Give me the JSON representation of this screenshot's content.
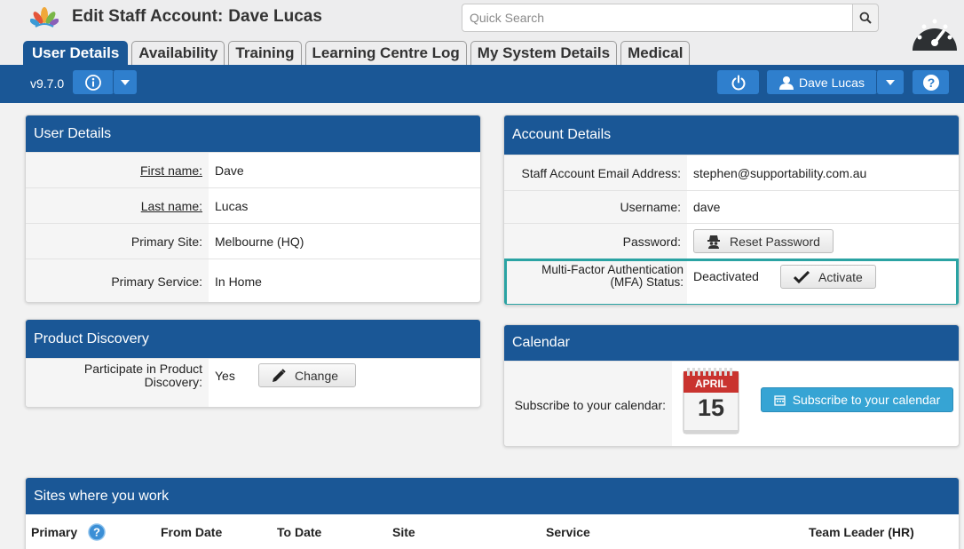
{
  "header": {
    "title": "Edit Staff Account:",
    "staff_name": "Dave Lucas",
    "search_placeholder": "Quick Search"
  },
  "tabs": [
    "User Details",
    "Availability",
    "Training",
    "Learning Centre Log",
    "My System Details",
    "Medical"
  ],
  "navbar": {
    "version": "v9.7.0",
    "user_name": "Dave Lucas"
  },
  "user_details": {
    "title": "User Details",
    "rows": [
      {
        "label": "First name:",
        "value": "Dave"
      },
      {
        "label": "Last name:",
        "value": "Lucas"
      },
      {
        "label": "Primary Site:",
        "value": "Melbourne (HQ)"
      },
      {
        "label": "Primary Service:",
        "value": "In Home"
      }
    ]
  },
  "product_discovery": {
    "title": "Product Discovery",
    "label_line1": "Participate in Product",
    "label_line2": "Discovery:",
    "value": "Yes",
    "change_label": "Change"
  },
  "account_details": {
    "title": "Account Details",
    "email_label": "Staff Account Email Address:",
    "email_value": "stephen@supportability.com.au",
    "username_label": "Username:",
    "username_value": "dave",
    "password_label": "Password:",
    "reset_label": "Reset Password",
    "mfa_label_line1": "Multi-Factor Authentication",
    "mfa_label_line2": "(MFA) Status:",
    "mfa_status": "Deactivated",
    "activate_label": "Activate"
  },
  "calendar": {
    "title": "Calendar",
    "label": "Subscribe to your calendar:",
    "icon_month": "APRIL",
    "icon_day": "15",
    "button_label": "Subscribe to your calendar"
  },
  "sites": {
    "title": "Sites where you work",
    "columns": [
      "Primary",
      "From Date",
      "To Date",
      "Site",
      "Service",
      "Team Leader (HR)"
    ]
  },
  "colors": {
    "brand_blue": "#1a5796",
    "button_blue": "#2f7fcd",
    "calendar_button": "#36a4d4",
    "mfa_highlight": "#2aa3a3"
  }
}
